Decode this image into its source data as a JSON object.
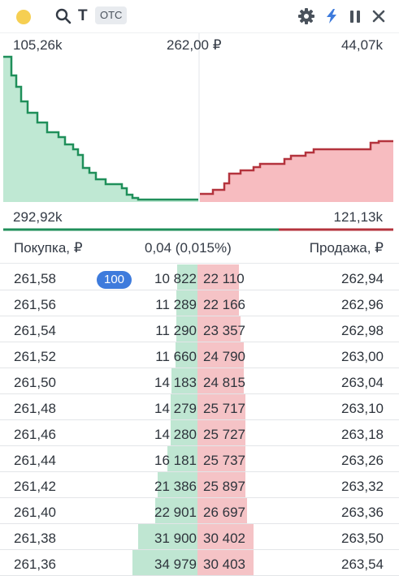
{
  "toolbar": {
    "ticker": "T",
    "market_badge": "OTC",
    "icons": [
      "search-icon",
      "gear-icon",
      "lightning-icon",
      "pause-icon",
      "close-icon"
    ],
    "status_color": "#f6cf52",
    "accent_color": "#3e7bdc"
  },
  "depth_chart": {
    "bid_total_top": "105,26k",
    "mid_price": "262,00 ₽",
    "ask_total_top": "44,07k",
    "bid_total_bottom": "292,92k",
    "ask_total_bottom": "121,13k",
    "bid_color": "#1f8f5a",
    "ask_color": "#b4333d"
  },
  "header": {
    "buy_label": "Покупка, ₽",
    "spread": "0,04 (0,015%)",
    "sell_label": "Продажа, ₽"
  },
  "order_book": {
    "my_order_qty": "100",
    "rows": [
      {
        "bid_price": "261,58",
        "bid_volume": "10 822",
        "ask_volume": "22 110",
        "ask_price": "262,94"
      },
      {
        "bid_price": "261,56",
        "bid_volume": "11 289",
        "ask_volume": "22 166",
        "ask_price": "262,96"
      },
      {
        "bid_price": "261,54",
        "bid_volume": "11 290",
        "ask_volume": "23 357",
        "ask_price": "262,98"
      },
      {
        "bid_price": "261,52",
        "bid_volume": "11 660",
        "ask_volume": "24 790",
        "ask_price": "263,00"
      },
      {
        "bid_price": "261,50",
        "bid_volume": "14 183",
        "ask_volume": "24 815",
        "ask_price": "263,04"
      },
      {
        "bid_price": "261,48",
        "bid_volume": "14 279",
        "ask_volume": "25 717",
        "ask_price": "263,10"
      },
      {
        "bid_price": "261,46",
        "bid_volume": "14 280",
        "ask_volume": "25 727",
        "ask_price": "263,18"
      },
      {
        "bid_price": "261,44",
        "bid_volume": "16 181",
        "ask_volume": "25 737",
        "ask_price": "263,26"
      },
      {
        "bid_price": "261,42",
        "bid_volume": "21 386",
        "ask_volume": "25 897",
        "ask_price": "263,32"
      },
      {
        "bid_price": "261,40",
        "bid_volume": "22 901",
        "ask_volume": "26 697",
        "ask_price": "263,36"
      },
      {
        "bid_price": "261,38",
        "bid_volume": "31 900",
        "ask_volume": "30 402",
        "ask_price": "263,50"
      },
      {
        "bid_price": "261,36",
        "bid_volume": "34 979",
        "ask_volume": "30 403",
        "ask_price": "263,54"
      }
    ]
  }
}
